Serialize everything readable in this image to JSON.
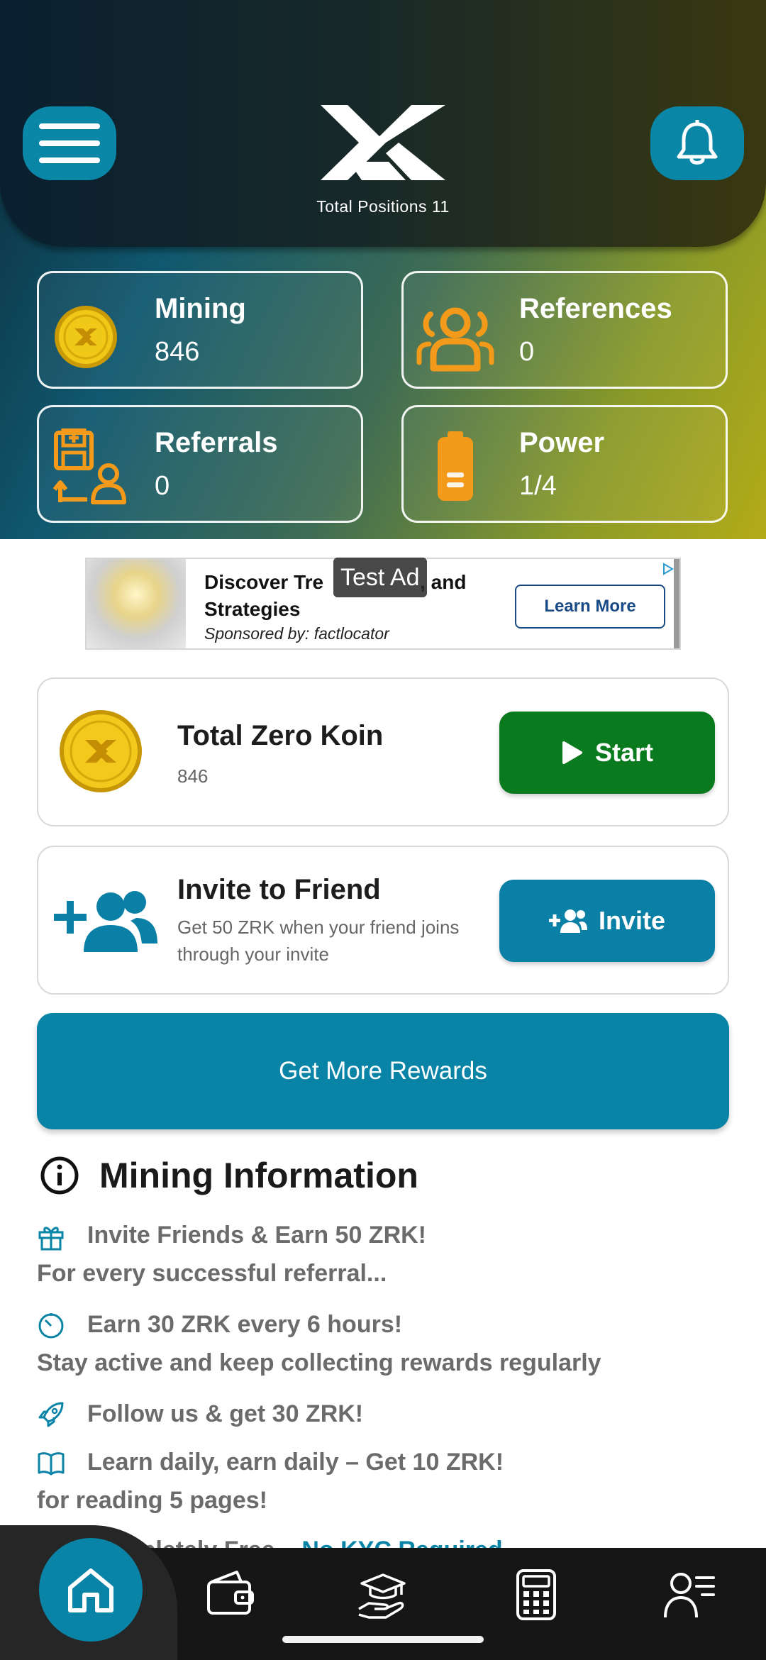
{
  "header": {
    "total_positions": "Total Positions 11",
    "menu_icon": "hamburger-menu-icon",
    "bell_icon": "bell-icon",
    "logo": "zk-logo"
  },
  "stats": [
    {
      "label": "Mining",
      "value": "846",
      "icon": "gold-coin-icon"
    },
    {
      "label": "References",
      "value": "0",
      "icon": "people-icon"
    },
    {
      "label": "Referrals",
      "value": "0",
      "icon": "referral-icon"
    },
    {
      "label": "Power",
      "value": "1/4",
      "icon": "battery-icon"
    }
  ],
  "ad": {
    "title_part1": "Discover Tre",
    "title_part2": ", and",
    "title_line2": "Strategies",
    "badge": "Test Ad",
    "sponsor": "Sponsored by: factlocator",
    "cta": "Learn More"
  },
  "koin_card": {
    "title": "Total Zero Koin",
    "value": "846",
    "button": "Start"
  },
  "invite_card": {
    "title": "Invite to Friend",
    "subtitle": "Get 50 ZRK when your friend joins through your invite",
    "button": "Invite"
  },
  "rewards_button": "Get More Rewards",
  "info": {
    "heading": "Mining Information",
    "line1": "Invite Friends & Earn 50 ZRK!",
    "line1b": "For every successful referral...",
    "line2": "Earn 30 ZRK every 6 hours!",
    "line2b": "Stay active and keep collecting rewards regularly",
    "line3": "Follow us & get 30 ZRK!",
    "line4": "Learn daily, earn daily – Get 10 ZRK!",
    "line4b": "for reading 5 pages!",
    "line5a": "Completely Free – ",
    "line5b": "No KYC Required"
  },
  "colors": {
    "accent": "#0a84a6",
    "start": "#0a7a1e",
    "coin": "#e8c21a",
    "orange": "#f39a1a"
  }
}
